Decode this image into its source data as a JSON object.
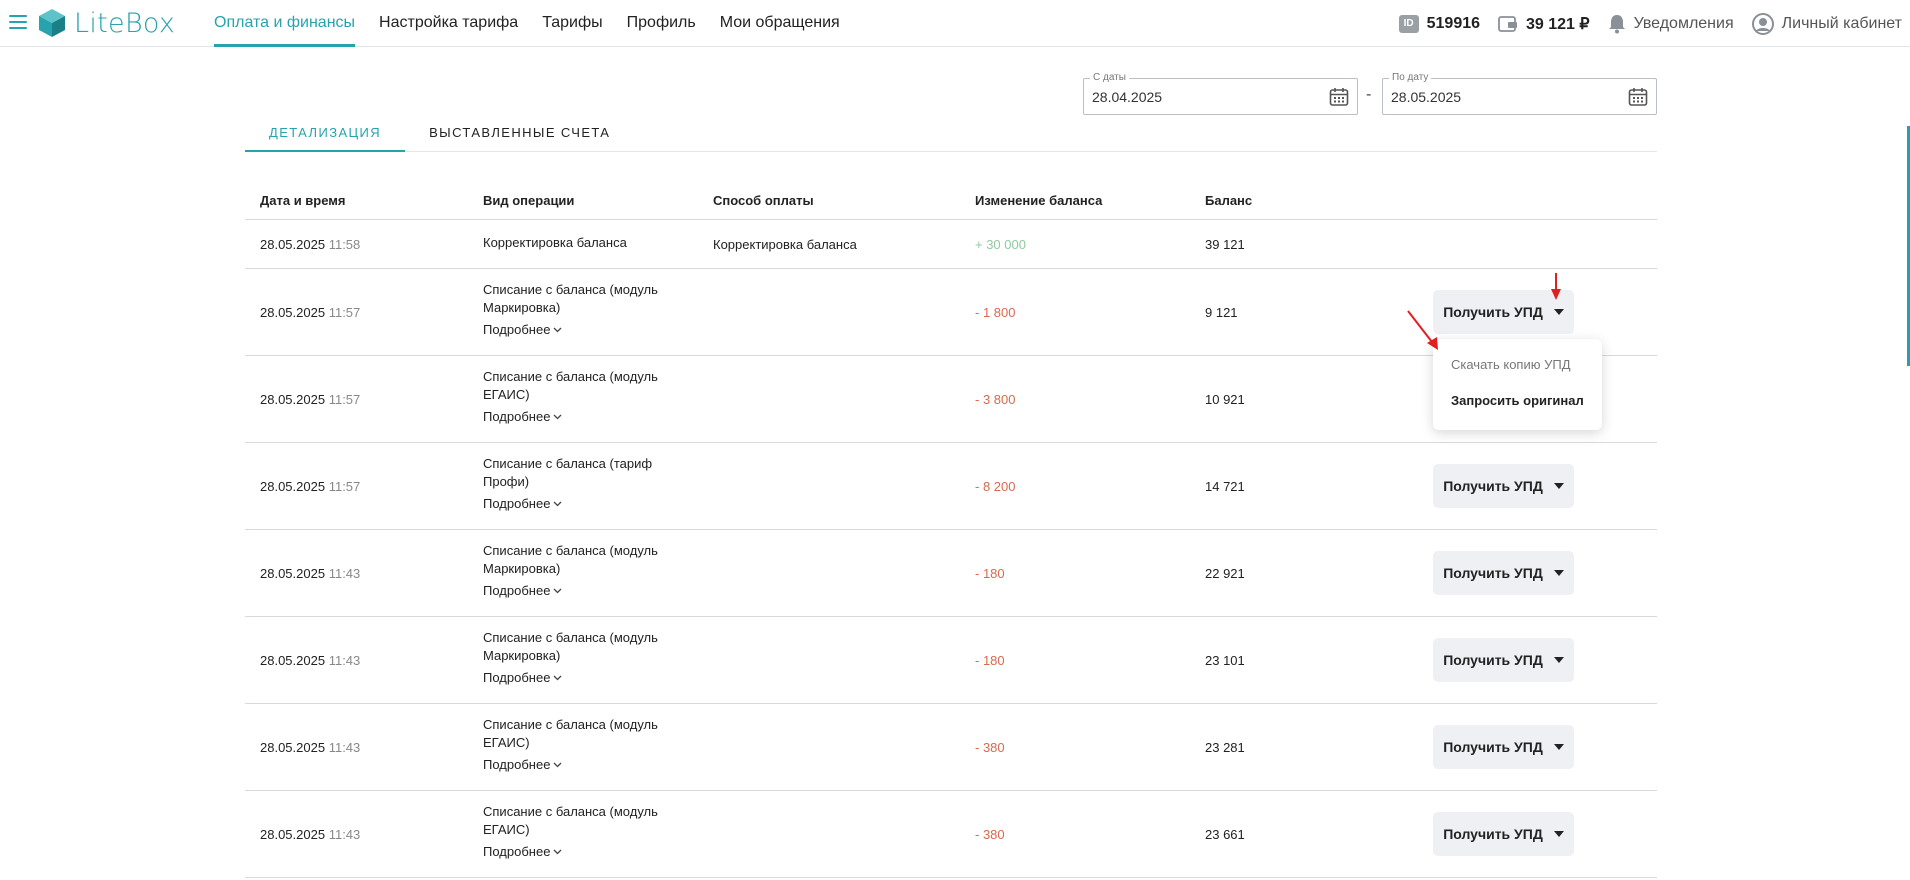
{
  "app": {
    "logo_text": "LiteBox",
    "accent_color": "#27a3ad"
  },
  "nav": {
    "items": [
      {
        "label": "Оплата и финансы",
        "active": true
      },
      {
        "label": "Настройка тарифа"
      },
      {
        "label": "Тарифы"
      },
      {
        "label": "Профиль"
      },
      {
        "label": "Мои обращения"
      }
    ]
  },
  "header_right": {
    "id_badge": "ID",
    "id_value": "519916",
    "balance": "39 121 ₽",
    "notifications": "Уведомления",
    "account": "Личный кабинет"
  },
  "date_range": {
    "from_label": "С даты",
    "from_value": "28.04.2025",
    "separator": "-",
    "to_label": "По дату",
    "to_value": "28.05.2025"
  },
  "tabs": [
    {
      "label": "ДЕТАЛИЗАЦИЯ",
      "active": true
    },
    {
      "label": "ВЫСТАВЛЕННЫЕ СЧЕТА"
    }
  ],
  "table": {
    "columns": [
      "Дата и время",
      "Вид операции",
      "Способ оплаты",
      "Изменение баланса",
      "Баланс"
    ],
    "more_label": "Подробнее",
    "upd_label": "Получить УПД",
    "rows": [
      {
        "date": "28.05.2025",
        "time": "11:58",
        "op": "Корректировка баланса",
        "pay": "Корректировка баланса",
        "change": "+ 30 000",
        "balance": "39 121"
      },
      {
        "date": "28.05.2025",
        "time": "11:57",
        "op": "Списание с баланса (модуль Маркировка)",
        "pay": "",
        "change": "- 1 800",
        "balance": "9 121"
      },
      {
        "date": "28.05.2025",
        "time": "11:57",
        "op": "Списание с баланса (модуль ЕГАИС)",
        "pay": "",
        "change": "- 3 800",
        "balance": "10 921"
      },
      {
        "date": "28.05.2025",
        "time": "11:57",
        "op": "Списание с баланса (тариф Профи)",
        "pay": "",
        "change": "- 8 200",
        "balance": "14 721"
      },
      {
        "date": "28.05.2025",
        "time": "11:43",
        "op": "Списание с баланса (модуль Маркировка)",
        "pay": "",
        "change": "- 180",
        "balance": "22 921"
      },
      {
        "date": "28.05.2025",
        "time": "11:43",
        "op": "Списание с баланса (модуль Маркировка)",
        "pay": "",
        "change": "- 180",
        "balance": "23 101"
      },
      {
        "date": "28.05.2025",
        "time": "11:43",
        "op": "Списание с баланса (модуль ЕГАИС)",
        "pay": "",
        "change": "- 380",
        "balance": "23 281"
      },
      {
        "date": "28.05.2025",
        "time": "11:43",
        "op": "Списание с баланса (модуль ЕГАИС)",
        "pay": "",
        "change": "- 380",
        "balance": "23 661"
      }
    ]
  },
  "dropdown": {
    "items": [
      "Скачать копию УПД",
      "Запросить оригинал"
    ]
  }
}
